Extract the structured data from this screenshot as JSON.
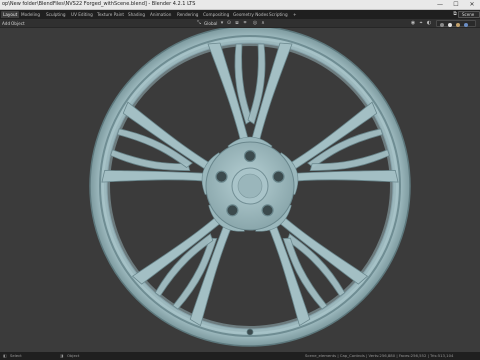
{
  "window": {
    "title": "op\\New folder\\BlendFiles\\NVS22 Forged_withScene.blend] - Blender 4.2.1 LTS",
    "minimize": "—",
    "maximize": "☐",
    "close": "✕"
  },
  "workspaces": [
    {
      "label": "Layout",
      "active": true
    },
    {
      "label": "Modeling",
      "active": false
    },
    {
      "label": "Sculpting",
      "active": false
    },
    {
      "label": "UV Editing",
      "active": false
    },
    {
      "label": "Texture Paint",
      "active": false
    },
    {
      "label": "Shading",
      "active": false
    },
    {
      "label": "Animation",
      "active": false
    },
    {
      "label": "Rendering",
      "active": false
    },
    {
      "label": "Compositing",
      "active": false
    },
    {
      "label": "Geometry Nodes",
      "active": false
    },
    {
      "label": "Scripting",
      "active": false
    },
    {
      "label": "+",
      "active": false
    }
  ],
  "scene_selector": {
    "label": "Scene"
  },
  "header": {
    "add_label": "Add",
    "object_label": "Object",
    "transform_orientation": "Global"
  },
  "colors": {
    "wheel": "#a3bfc4",
    "wheel_dark": "#6f8d93",
    "wheel_edge": "#5d787d",
    "viewport_bg": "#3b3b3b"
  },
  "status": {
    "left_label": "Select",
    "right_info": "Scene_elements | Cap_Controls | Verts:256,880 | Faces:256,552 | Tris:513,104"
  }
}
